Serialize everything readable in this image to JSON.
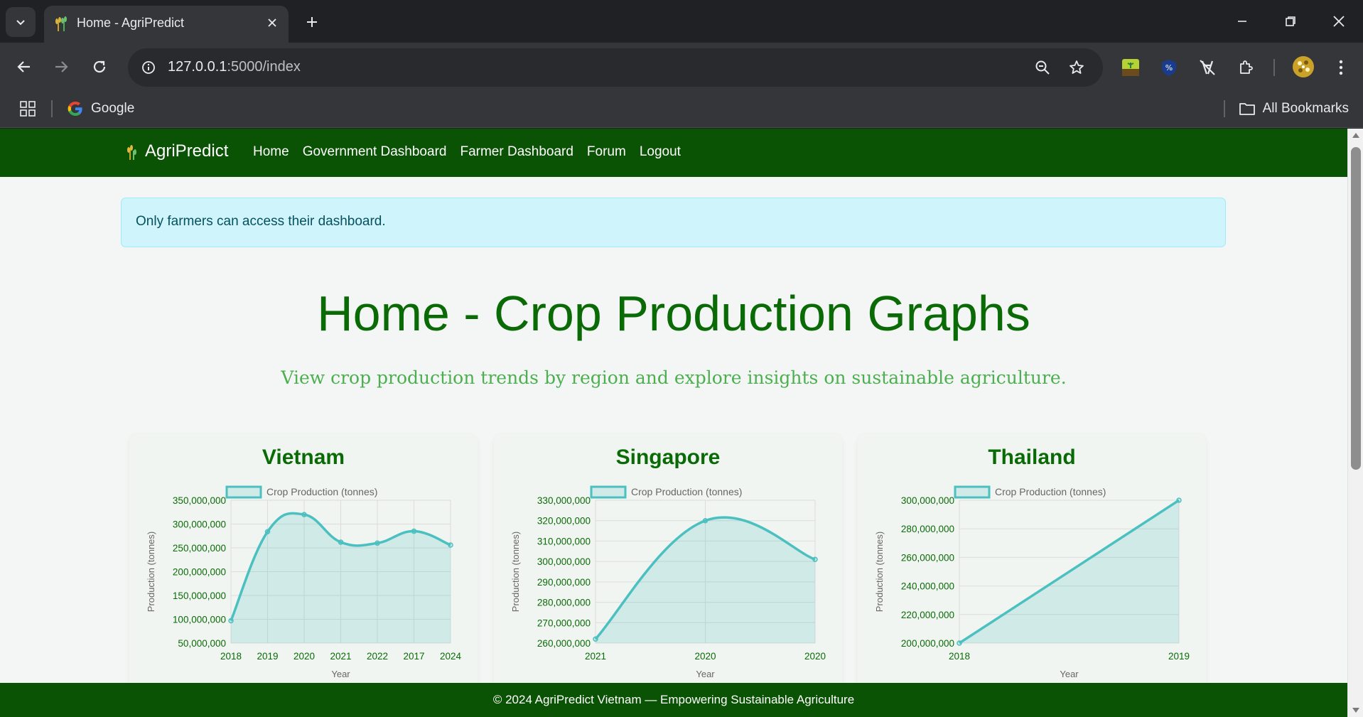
{
  "browser": {
    "tab_title": "Home - AgriPredict",
    "url_host": "127.0.0.1",
    "url_rest": ":5000/index",
    "bookmarks": {
      "google": "Google",
      "all": "All Bookmarks"
    }
  },
  "site": {
    "brand": "AgriPredict",
    "nav": [
      {
        "label": "Home"
      },
      {
        "label": "Government Dashboard"
      },
      {
        "label": "Farmer Dashboard"
      },
      {
        "label": "Forum"
      },
      {
        "label": "Logout"
      }
    ],
    "alert": "Only farmers can access their dashboard.",
    "title": "Home - Crop Production Graphs",
    "subtitle": "View crop production trends by region and explore insights on sustainable agriculture.",
    "footer": "© 2024 AgriPredict Vietnam — Empowering Sustainable Agriculture"
  },
  "colors": {
    "brand_green": "#0a5204",
    "title_green": "#0a6b06",
    "line": "#4bc0c0",
    "fill": "rgba(75,192,192,0.2)"
  },
  "chart_data": [
    {
      "type": "line",
      "title": "Vietnam",
      "legend": "Crop Production (tonnes)",
      "xlabel": "Year",
      "ylabel": "Production (tonnes)",
      "x": [
        "2018",
        "2019",
        "2020",
        "2021",
        "2022",
        "2017",
        "2024"
      ],
      "values": [
        97000000,
        284000000,
        320000000,
        262000000,
        260000000,
        285000000,
        256000000
      ],
      "ylim": [
        50000000,
        350000000
      ],
      "yticks": [
        "350,000,000",
        "300,000,000",
        "250,000,000",
        "200,000,000",
        "150,000,000",
        "100,000,000",
        "50,000,000"
      ],
      "grid": true,
      "smooth": true
    },
    {
      "type": "line",
      "title": "Singapore",
      "legend": "Crop Production (tonnes)",
      "xlabel": "Year",
      "ylabel": "Production (tonnes)",
      "x": [
        "2021",
        "2020",
        "2020"
      ],
      "values": [
        262000000,
        320000000,
        301000000
      ],
      "ylim": [
        260000000,
        330000000
      ],
      "yticks": [
        "330,000,000",
        "320,000,000",
        "310,000,000",
        "300,000,000",
        "290,000,000",
        "280,000,000",
        "270,000,000",
        "260,000,000"
      ],
      "grid": true,
      "smooth": true
    },
    {
      "type": "line",
      "title": "Thailand",
      "legend": "Crop Production (tonnes)",
      "xlabel": "Year",
      "ylabel": "Production (tonnes)",
      "x": [
        "2018",
        "2019"
      ],
      "values": [
        200000000,
        300000000
      ],
      "ylim": [
        200000000,
        300000000
      ],
      "yticks": [
        "300,000,000",
        "280,000,000",
        "260,000,000",
        "240,000,000",
        "220,000,000",
        "200,000,000"
      ],
      "grid": true,
      "smooth": false
    }
  ]
}
